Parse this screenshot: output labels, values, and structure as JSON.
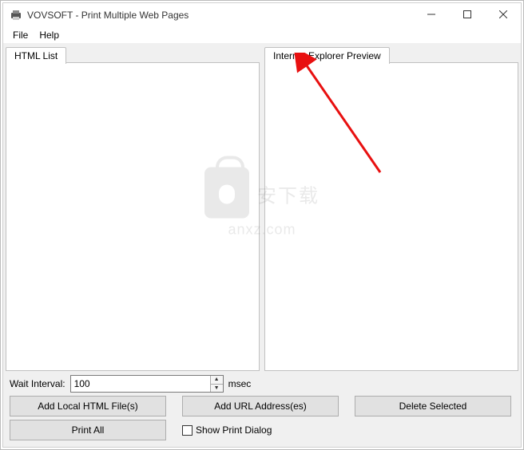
{
  "window": {
    "title": "VOVSOFT - Print Multiple Web Pages"
  },
  "menu": {
    "file": "File",
    "help": "Help"
  },
  "tabs": {
    "left": "HTML List",
    "right": "Internet Explorer Preview"
  },
  "controls": {
    "wait_interval_label": "Wait Interval:",
    "wait_interval_value": "100",
    "msec": "msec",
    "add_local": "Add Local HTML File(s)",
    "add_url": "Add URL Address(es)",
    "delete_selected": "Delete Selected",
    "print_all": "Print All",
    "show_print_dialog": "Show Print Dialog"
  },
  "watermark": {
    "cn": "安下载",
    "en": "anxz.com"
  }
}
